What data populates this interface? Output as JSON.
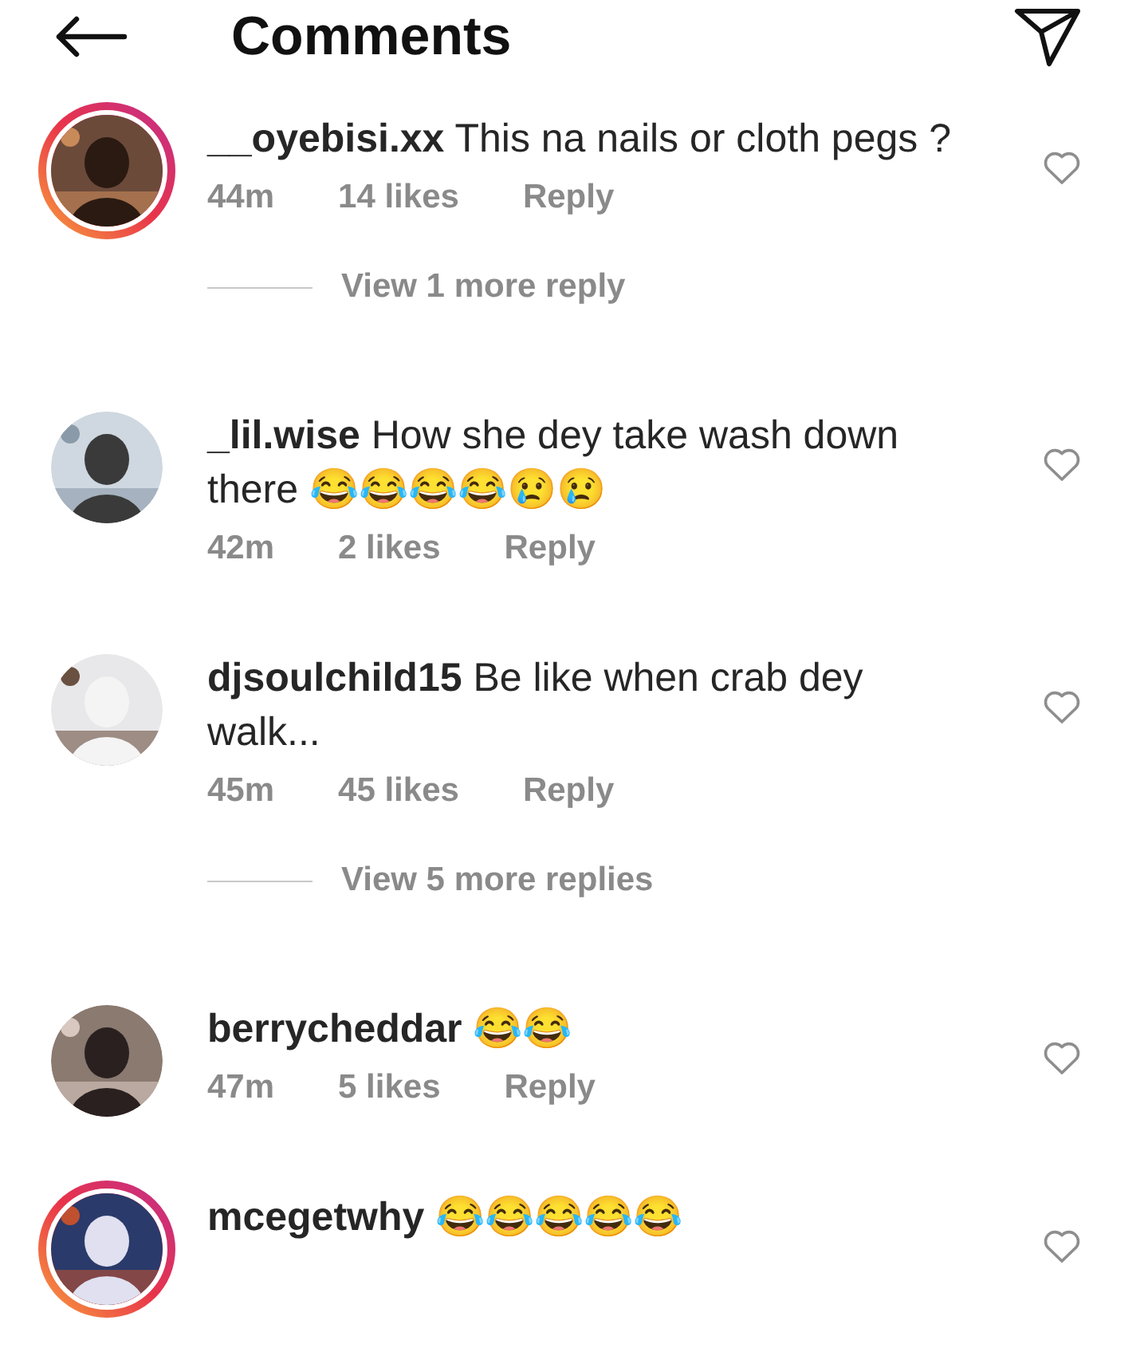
{
  "header": {
    "title": "Comments"
  },
  "comments": [
    {
      "username": "__oyebisi.xx",
      "text": "This na nails or cloth pegs ?",
      "time": "44m",
      "likes": "14 likes",
      "reply": "Reply",
      "story": true,
      "more_replies": "View 1 more reply"
    },
    {
      "username": "_lil.wise",
      "text": "How she dey take wash down there 😂😂😂😂😢😢",
      "time": "42m",
      "likes": "2 likes",
      "reply": "Reply",
      "story": false
    },
    {
      "username": "djsoulchild15",
      "text": "Be like when crab dey walk...",
      "time": "45m",
      "likes": "45 likes",
      "reply": "Reply",
      "story": false,
      "more_replies": "View 5 more replies"
    },
    {
      "username": "berrycheddar",
      "text": "😂😂",
      "time": "47m",
      "likes": "5 likes",
      "reply": "Reply",
      "story": false
    },
    {
      "username": "mcegetwhy",
      "text": "😂😂😂😂😂",
      "story": true
    }
  ]
}
